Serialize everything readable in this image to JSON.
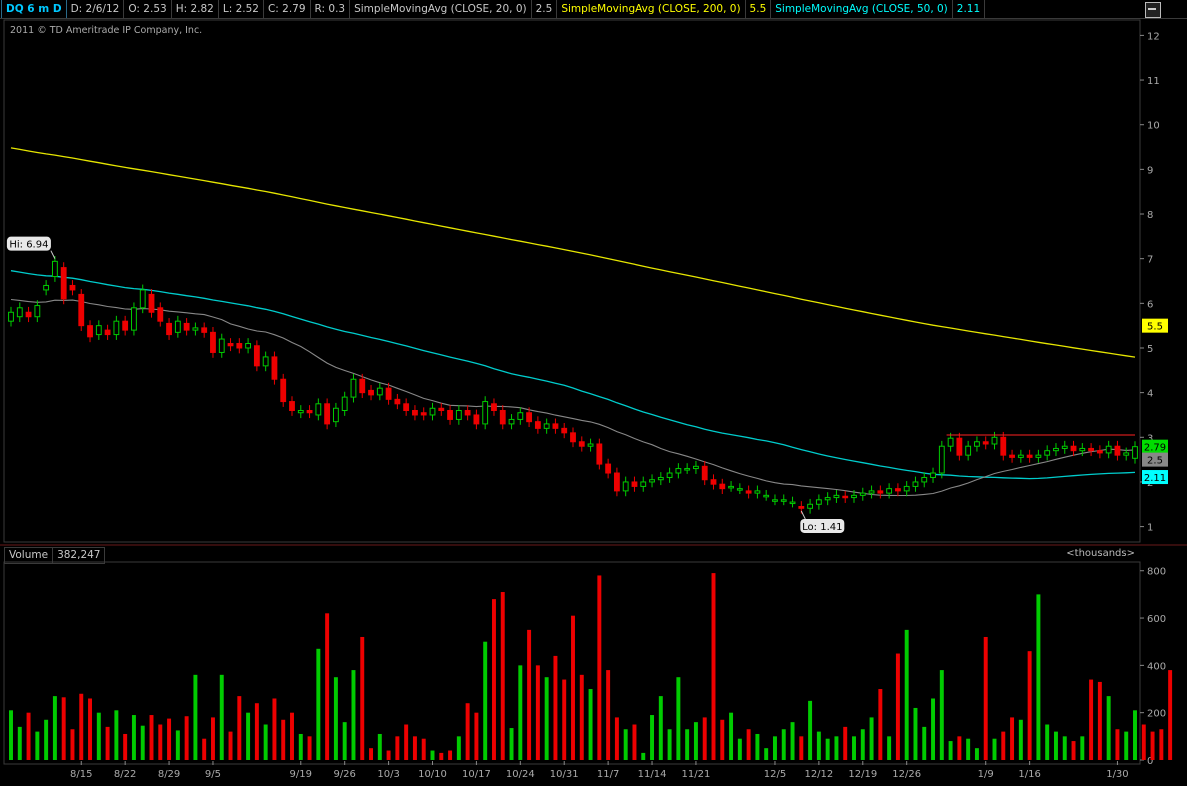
{
  "header": {
    "symbol": "DQ 6 m D",
    "date": "D: 2/6/12",
    "open": "O: 2.53",
    "high": "H: 2.82",
    "low": "L: 2.52",
    "close": "C: 2.79",
    "range": "R: 0.3",
    "sma20_label": "SimpleMovingAvg (CLOSE, 20, 0)",
    "sma20_value": "2.5",
    "sma200_label": "SimpleMovingAvg (CLOSE, 200, 0)",
    "sma200_value": "5.5",
    "sma50_label": "SimpleMovingAvg (CLOSE, 50, 0)",
    "sma50_value": "2.11"
  },
  "copyright": "2011 © TD Ameritrade IP Company, Inc.",
  "volume_header": {
    "label": "Volume",
    "value": "382,247",
    "units": "<thousands>"
  },
  "annotations": {
    "hi": "Hi: 6.94",
    "lo": "Lo: 1.41"
  },
  "price_badges": {
    "close": "2.79",
    "sma20": "2.5",
    "sma200": "5.5",
    "sma50": "2.11"
  },
  "colors": {
    "up": "#00cc00",
    "down": "#ee0000",
    "sma200": "#e6e600",
    "sma50": "#00cccc",
    "sma20": "#888888",
    "resistance": "#ff2222"
  },
  "chart_data": {
    "type": "candlestick",
    "y_ticks": [
      "12",
      "11",
      "10",
      "9",
      "8",
      "7",
      "6",
      "5",
      "4",
      "3",
      "2",
      "1"
    ],
    "ylim": [
      0.7,
      12.3
    ],
    "volume_ticks": [
      "800",
      "600",
      "400",
      "200",
      "0"
    ],
    "volume_ylim": [
      0,
      820
    ],
    "x_tick_labels": [
      {
        "label": "8/15",
        "idx": 8
      },
      {
        "label": "8/22",
        "idx": 13
      },
      {
        "label": "8/29",
        "idx": 18
      },
      {
        "label": "9/5",
        "idx": 23
      },
      {
        "label": "9/19",
        "idx": 33
      },
      {
        "label": "9/26",
        "idx": 38
      },
      {
        "label": "10/3",
        "idx": 43
      },
      {
        "label": "10/10",
        "idx": 48
      },
      {
        "label": "10/17",
        "idx": 53
      },
      {
        "label": "10/24",
        "idx": 58
      },
      {
        "label": "10/31",
        "idx": 63
      },
      {
        "label": "11/7",
        "idx": 68
      },
      {
        "label": "11/14",
        "idx": 73
      },
      {
        "label": "11/21",
        "idx": 78
      },
      {
        "label": "12/5",
        "idx": 87
      },
      {
        "label": "12/12",
        "idx": 92
      },
      {
        "label": "12/19",
        "idx": 97
      },
      {
        "label": "12/26",
        "idx": 102
      },
      {
        "label": "1/9",
        "idx": 111
      },
      {
        "label": "1/16",
        "idx": 116
      },
      {
        "label": "1/30",
        "idx": 126
      }
    ],
    "series_close": [
      5.8,
      5.9,
      5.7,
      5.95,
      6.4,
      6.94,
      6.1,
      6.3,
      5.5,
      5.25,
      5.5,
      5.3,
      5.6,
      5.4,
      5.9,
      6.3,
      5.8,
      5.6,
      5.3,
      5.6,
      5.4,
      5.45,
      5.35,
      4.9,
      5.2,
      5.05,
      5.0,
      5.1,
      4.6,
      4.8,
      4.3,
      3.8,
      3.6,
      3.6,
      3.55,
      3.75,
      3.3,
      3.65,
      3.9,
      4.3,
      4.0,
      3.95,
      4.1,
      3.85,
      3.75,
      3.6,
      3.5,
      3.5,
      3.65,
      3.6,
      3.4,
      3.6,
      3.5,
      3.3,
      3.8,
      3.6,
      3.3,
      3.4,
      3.55,
      3.35,
      3.2,
      3.3,
      3.2,
      3.1,
      2.9,
      2.8,
      2.85,
      2.4,
      2.2,
      1.8,
      2.0,
      1.9,
      2.0,
      2.05,
      2.1,
      2.2,
      2.3,
      2.3,
      2.35,
      2.05,
      1.95,
      1.85,
      1.9,
      1.85,
      1.75,
      1.8,
      1.7,
      1.6,
      1.6,
      1.55,
      1.41,
      1.5,
      1.6,
      1.65,
      1.7,
      1.65,
      1.7,
      1.75,
      1.8,
      1.75,
      1.85,
      1.8,
      1.9,
      2.0,
      2.1,
      2.2,
      2.8,
      2.98,
      2.6,
      2.8,
      2.9,
      2.85,
      3.0,
      2.6,
      2.55,
      2.6,
      2.55,
      2.6,
      2.7,
      2.75,
      2.8,
      2.7,
      2.75,
      2.7,
      2.65,
      2.8,
      2.6,
      2.65,
      2.79
    ],
    "series_open": [
      5.6,
      5.7,
      5.8,
      5.7,
      6.3,
      6.6,
      6.8,
      6.4,
      6.2,
      5.5,
      5.3,
      5.4,
      5.3,
      5.6,
      5.4,
      5.9,
      6.2,
      5.9,
      5.55,
      5.35,
      5.55,
      5.4,
      5.45,
      5.35,
      4.9,
      5.1,
      5.1,
      5.0,
      5.05,
      4.6,
      4.8,
      4.3,
      3.8,
      3.55,
      3.6,
      3.5,
      3.75,
      3.35,
      3.6,
      3.9,
      4.3,
      4.05,
      3.95,
      4.1,
      3.85,
      3.75,
      3.6,
      3.55,
      3.5,
      3.65,
      3.6,
      3.4,
      3.6,
      3.5,
      3.3,
      3.75,
      3.6,
      3.3,
      3.4,
      3.55,
      3.35,
      3.2,
      3.3,
      3.2,
      3.1,
      2.9,
      2.8,
      2.85,
      2.4,
      2.2,
      1.8,
      2.0,
      1.9,
      2.0,
      2.05,
      2.1,
      2.2,
      2.3,
      2.3,
      2.35,
      2.05,
      1.95,
      1.9,
      1.85,
      1.8,
      1.75,
      1.7,
      1.6,
      1.6,
      1.55,
      1.45,
      1.41,
      1.5,
      1.6,
      1.65,
      1.68,
      1.65,
      1.7,
      1.75,
      1.8,
      1.75,
      1.85,
      1.8,
      1.9,
      2.0,
      2.1,
      2.2,
      2.8,
      2.98,
      2.6,
      2.8,
      2.9,
      2.85,
      3.0,
      2.6,
      2.55,
      2.6,
      2.55,
      2.6,
      2.7,
      2.75,
      2.8,
      2.7,
      2.75,
      2.7,
      2.65,
      2.8,
      2.6,
      2.53
    ],
    "volume": [
      210,
      140,
      200,
      120,
      170,
      270,
      265,
      130,
      280,
      260,
      200,
      140,
      210,
      110,
      190,
      145,
      190,
      150,
      175,
      125,
      185,
      360,
      90,
      180,
      360,
      120,
      270,
      200,
      240,
      150,
      260,
      170,
      200,
      110,
      100,
      470,
      620,
      350,
      160,
      380,
      520,
      50,
      110,
      40,
      100,
      150,
      100,
      90,
      40,
      30,
      40,
      100,
      240,
      200,
      500,
      680,
      710,
      135,
      400,
      550,
      400,
      350,
      440,
      340,
      610,
      360,
      300,
      780,
      380,
      180,
      130,
      150,
      30,
      190,
      270,
      130,
      350,
      130,
      160,
      180,
      790,
      170,
      200,
      90,
      130,
      110,
      50,
      100,
      130,
      160,
      100,
      250,
      120,
      90,
      100,
      140,
      100,
      130,
      180,
      300,
      100,
      450,
      550,
      220,
      140,
      260,
      380,
      80,
      100,
      90,
      50,
      520,
      90,
      120,
      180,
      170,
      460,
      700,
      150,
      120,
      100,
      80,
      100,
      340,
      330,
      270,
      130,
      120,
      210,
      150,
      120,
      130,
      380
    ]
  }
}
